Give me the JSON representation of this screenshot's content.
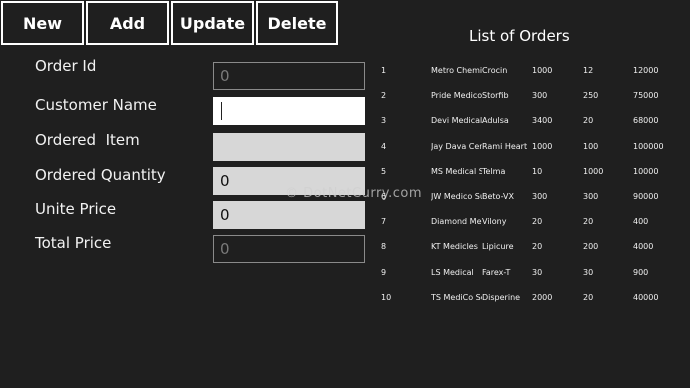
{
  "toolbar": {
    "new_label": "New",
    "add_label": "Add",
    "update_label": "Update",
    "delete_label": "Delete"
  },
  "form": {
    "order_id_label": "Order Id",
    "order_id_value": "0",
    "customer_name_label": "Customer Name",
    "customer_name_value": "",
    "ordered_item_label": "Ordered  Item",
    "ordered_item_value": "",
    "ordered_quantity_label": "Ordered Quantity",
    "ordered_quantity_value": "0",
    "unite_price_label": "Unite Price",
    "unite_price_value": "0",
    "total_price_label": "Total Price",
    "total_price_value": "0"
  },
  "list": {
    "title": "List of Orders",
    "rows": [
      [
        "1",
        "Metro Chemist",
        "Crocin",
        "1000",
        "12",
        "12000"
      ],
      [
        "2",
        "Pride Medico",
        "Storfib",
        "300",
        "250",
        "75000"
      ],
      [
        "3",
        "Devi Medical",
        "Adulsa",
        "3400",
        "20",
        "68000"
      ],
      [
        "4",
        "Jay Dava Center",
        "Rami Heart",
        "1000",
        "100",
        "100000"
      ],
      [
        "5",
        "MS Medical Sto",
        "Telma",
        "10",
        "1000",
        "10000"
      ],
      [
        "6",
        "JW Medico Sup",
        "Beto-VX",
        "300",
        "300",
        "90000"
      ],
      [
        "7",
        "Diamond Medi",
        "Vilony",
        "20",
        "20",
        "400"
      ],
      [
        "8",
        "KT Medicles",
        "Lipicure",
        "20",
        "200",
        "4000"
      ],
      [
        "9",
        "LS Medical",
        "Farex-T",
        "30",
        "30",
        "900"
      ],
      [
        "10",
        "TS MediCo Serv",
        "Disperine",
        "2000",
        "20",
        "40000"
      ]
    ]
  },
  "watermark": "© DotNetCurry.com"
}
